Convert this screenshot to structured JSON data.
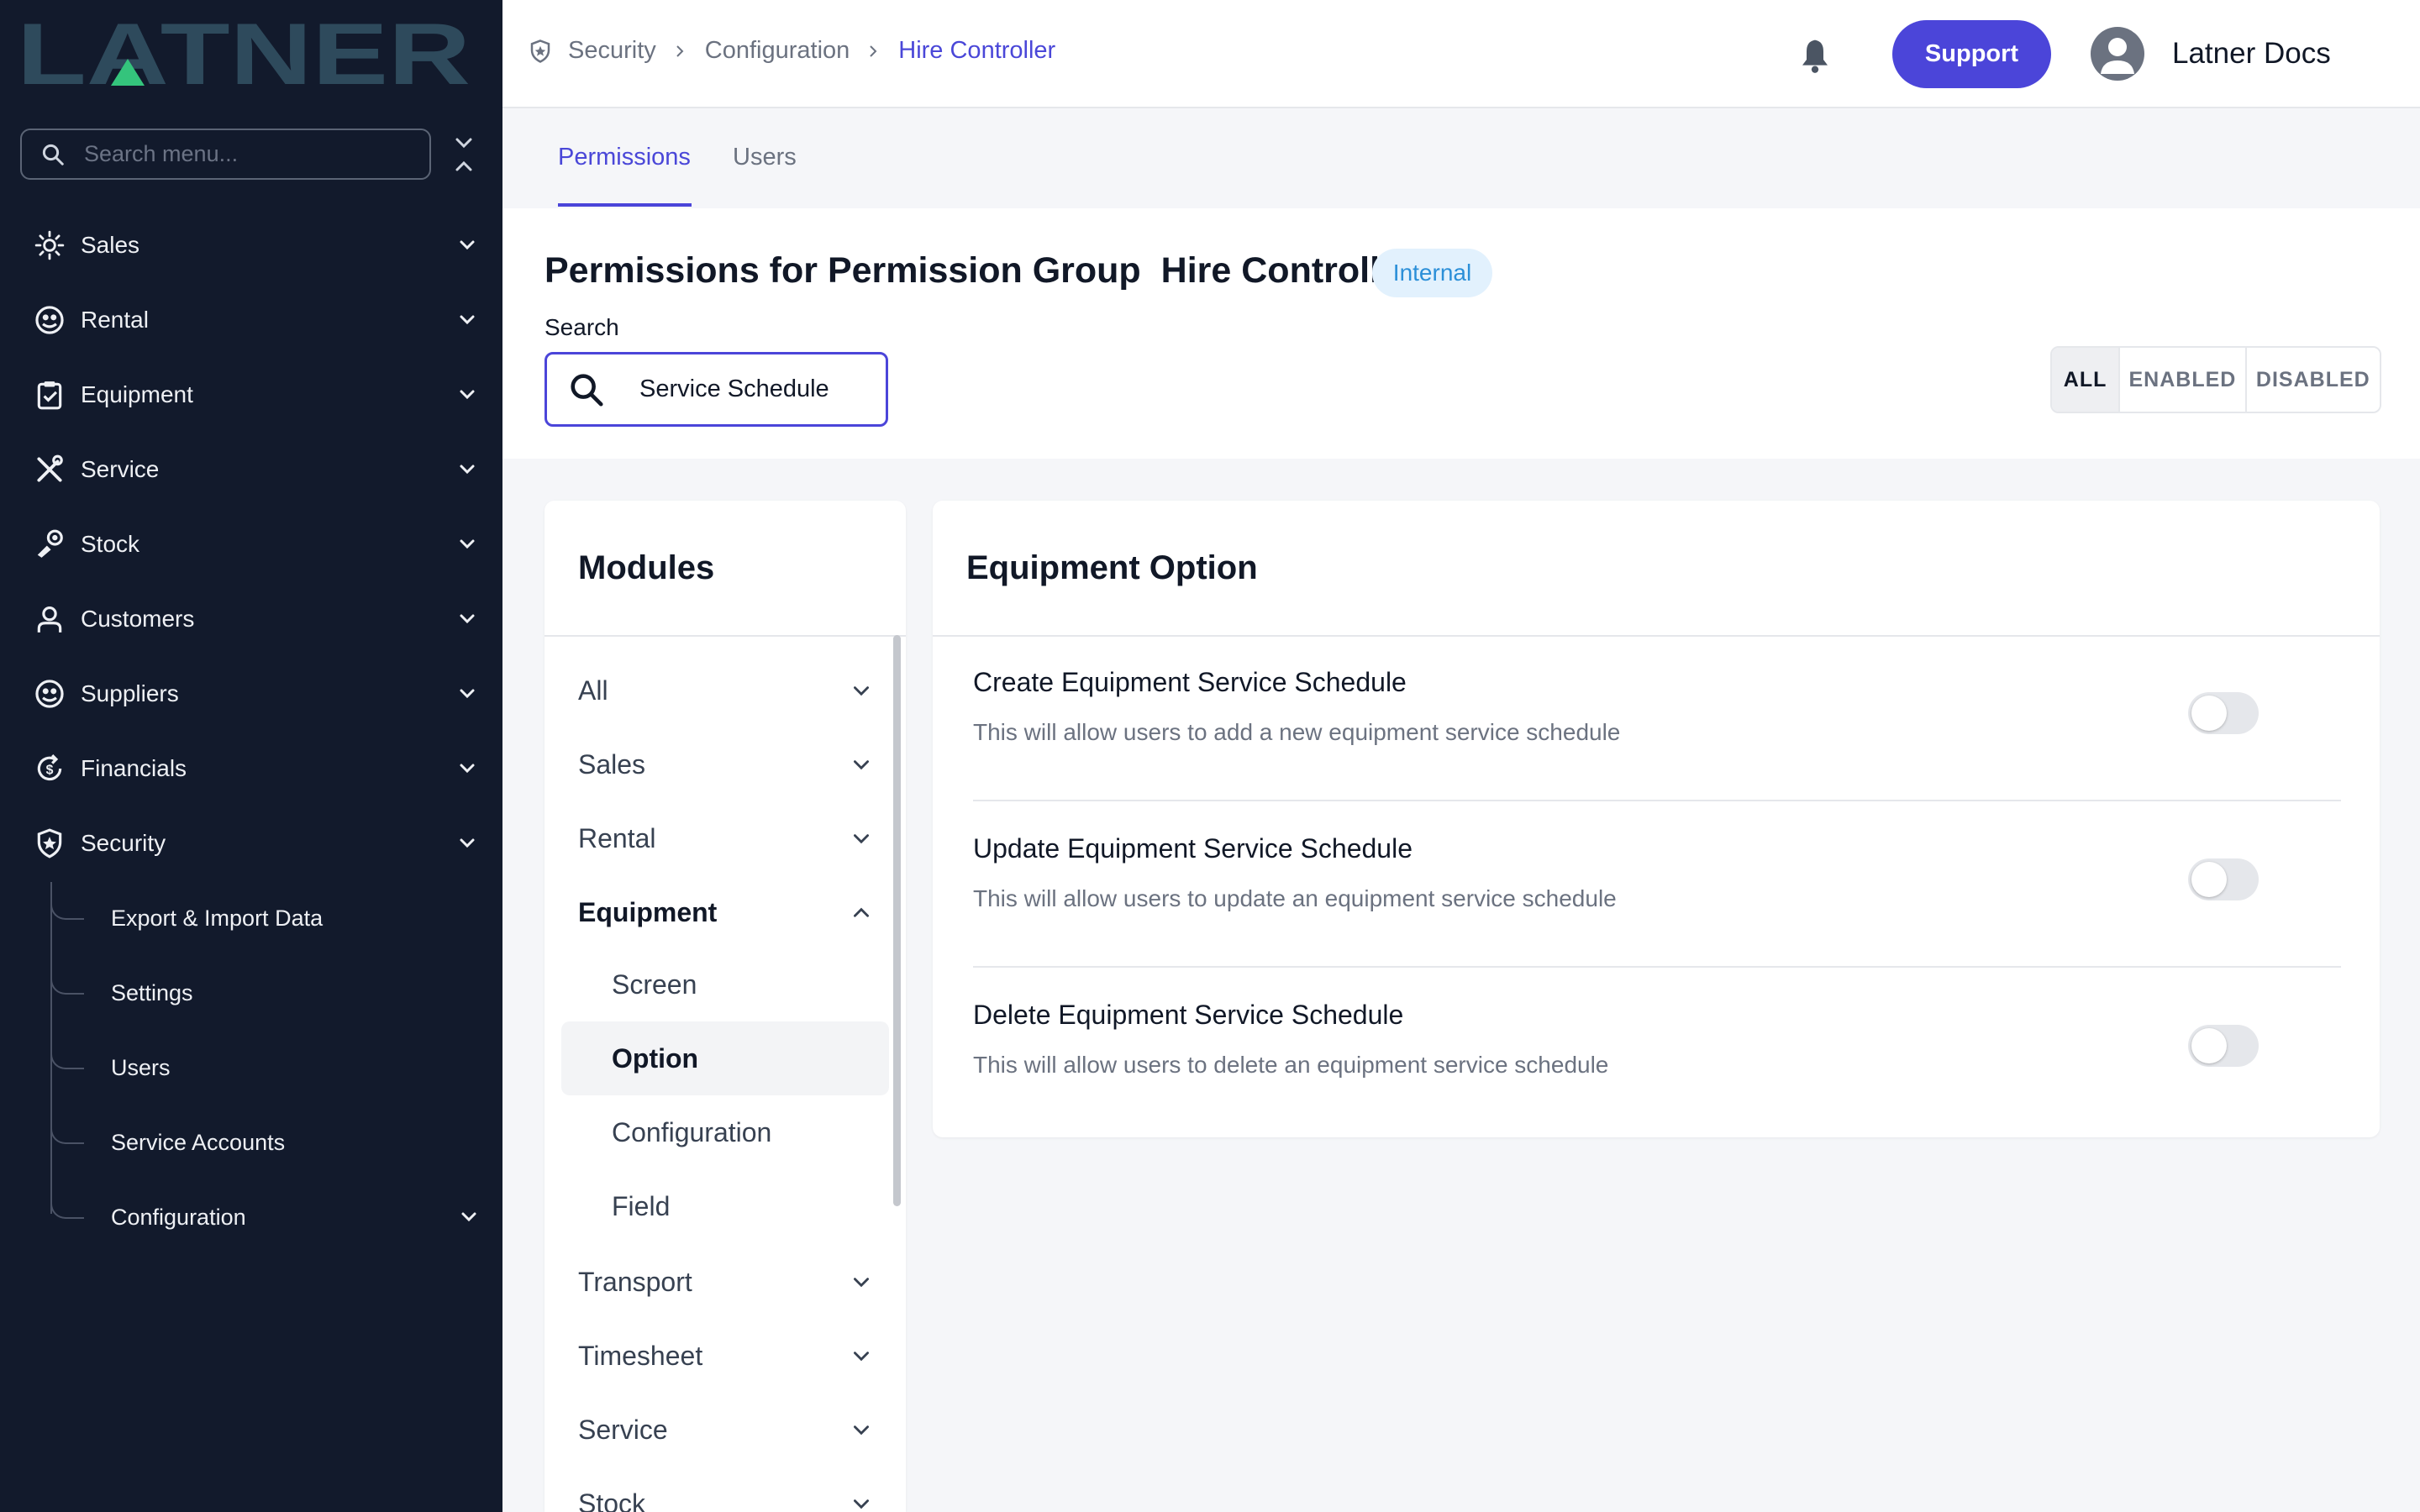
{
  "brand": {
    "logo_text": "LATNER",
    "logo_color": "#2e4a5c",
    "accent": "#34c47c"
  },
  "sidebar": {
    "search_placeholder": "Search menu...",
    "items": [
      {
        "label": "Sales",
        "icon": "sales-icon"
      },
      {
        "label": "Rental",
        "icon": "rental-icon"
      },
      {
        "label": "Equipment",
        "icon": "equipment-icon"
      },
      {
        "label": "Service",
        "icon": "service-icon"
      },
      {
        "label": "Stock",
        "icon": "stock-icon"
      },
      {
        "label": "Customers",
        "icon": "customers-icon"
      },
      {
        "label": "Suppliers",
        "icon": "suppliers-icon"
      },
      {
        "label": "Financials",
        "icon": "financials-icon"
      },
      {
        "label": "Security",
        "icon": "security-icon"
      }
    ],
    "security_sub": [
      "Export & Import Data",
      "Settings",
      "Users",
      "Service Accounts",
      "Configuration"
    ]
  },
  "breadcrumb": [
    "Security",
    "Configuration",
    "Hire Controller"
  ],
  "header": {
    "support_label": "Support",
    "user_name": "Latner Docs"
  },
  "tabs": [
    "Permissions",
    "Users"
  ],
  "page": {
    "title_prefix": "Permissions for Permission Group",
    "group_name": "Hire Controller",
    "badge": "Internal",
    "search_label": "Search",
    "search_value": "Service Schedule",
    "filters": [
      "ALL",
      "ENABLED",
      "DISABLED"
    ]
  },
  "modules": {
    "title": "Modules",
    "items": [
      "All",
      "Sales",
      "Rental",
      "Equipment",
      "Transport",
      "Timesheet",
      "Service",
      "Stock"
    ],
    "equipment_sub": [
      "Screen",
      "Option",
      "Configuration",
      "Field"
    ],
    "selected": "Option"
  },
  "permissions": {
    "title": "Equipment Option",
    "rows": [
      {
        "name": "Create Equipment Service Schedule",
        "desc": "This will allow users to add a new equipment service schedule",
        "enabled": false
      },
      {
        "name": "Update Equipment Service Schedule",
        "desc": "This will allow users to update an equipment service schedule",
        "enabled": false
      },
      {
        "name": "Delete Equipment Service Schedule",
        "desc": "This will allow users to delete an equipment service schedule",
        "enabled": false
      }
    ]
  }
}
